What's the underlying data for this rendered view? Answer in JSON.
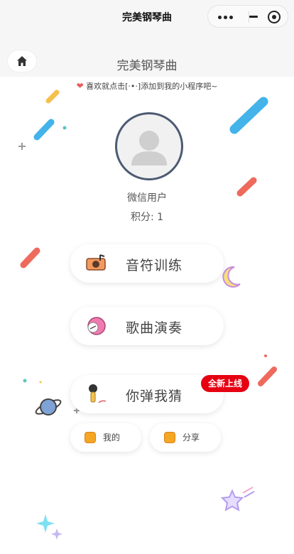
{
  "system_bar": {
    "title": "完美钢琴曲"
  },
  "app_header": {
    "title": "完美钢琴曲"
  },
  "tip": {
    "heart": "❤",
    "text": "喜欢就点击[·•·]添加到我的小程序吧~"
  },
  "user": {
    "name": "微信用户",
    "score_text": "积分: 1"
  },
  "menu": [
    {
      "label": "音符训练",
      "icon": "music-note-icon"
    },
    {
      "label": "歌曲演奏",
      "icon": "ribbon-icon"
    },
    {
      "label": "你弹我猜",
      "icon": "microphone-icon"
    }
  ],
  "new_badge": "全新上线",
  "actions": [
    {
      "label": "我的",
      "icon": "my-icon"
    },
    {
      "label": "分享",
      "icon": "share-icon"
    }
  ],
  "colors": {
    "badge": "#e60012",
    "avatar_border": "#4d5a72"
  }
}
